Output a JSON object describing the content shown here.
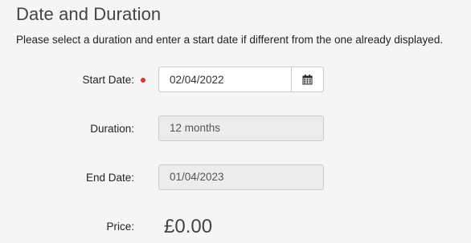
{
  "section": {
    "title": "Date and Duration",
    "intro": "Please select a duration and enter a start date if different from the one already displayed."
  },
  "start_date": {
    "label": "Start Date:",
    "value": "02/04/2022",
    "required": true
  },
  "duration": {
    "label": "Duration:",
    "value": "12 months"
  },
  "end_date": {
    "label": "End Date:",
    "value": "01/04/2023"
  },
  "price": {
    "label": "Price:",
    "value": "£0.00"
  },
  "icons": {
    "calendar": "calendar-icon",
    "required": "required-indicator"
  },
  "colors": {
    "required_dot": "#e0322f",
    "readonly_bg": "#ececec",
    "page_bg": "#f5f5f5"
  }
}
